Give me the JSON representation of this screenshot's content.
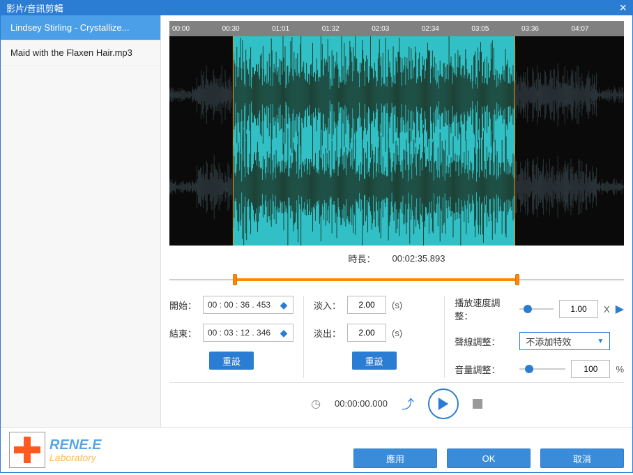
{
  "window": {
    "title": "影片/音訊剪輯"
  },
  "sidebar": {
    "items": [
      {
        "label": "Lindsey Stirling - Crystallize...",
        "active": true
      },
      {
        "label": "Maid with the Flaxen Hair.mp3",
        "active": false
      }
    ]
  },
  "timeline": {
    "ticks": [
      "00:00",
      "00:30",
      "01:01",
      "01:32",
      "02:03",
      "02:34",
      "03:05",
      "03:36",
      "04:07"
    ],
    "duration_label": "時長：",
    "duration_value": "00:02:35.893",
    "selection_start_pct": 14,
    "selection_end_pct": 76
  },
  "start": {
    "label": "開始：",
    "value": "00 : 00 : 36 . 453"
  },
  "end": {
    "label": "結束：",
    "value": "00 : 03 : 12 . 346"
  },
  "fadein": {
    "label": "淡入：",
    "value": "2.00",
    "unit": "(s)"
  },
  "fadeout": {
    "label": "淡出：",
    "value": "2.00",
    "unit": "(s)"
  },
  "reset_label": "重設",
  "speed": {
    "label": "播放速度調整：",
    "value": "1.00",
    "unit": "X",
    "knob_pct": 12
  },
  "voice": {
    "label": "聲線調整：",
    "selected": "不添加特效"
  },
  "volume": {
    "label": "音量調整：",
    "value": "100",
    "unit": "%",
    "knob_pct": 12
  },
  "playbar": {
    "time": "00:00:00.000"
  },
  "logo": {
    "line1": "RENE.E",
    "line2": "Laboratory"
  },
  "footer": {
    "apply": "應用",
    "ok": "OK",
    "cancel": "取消"
  }
}
